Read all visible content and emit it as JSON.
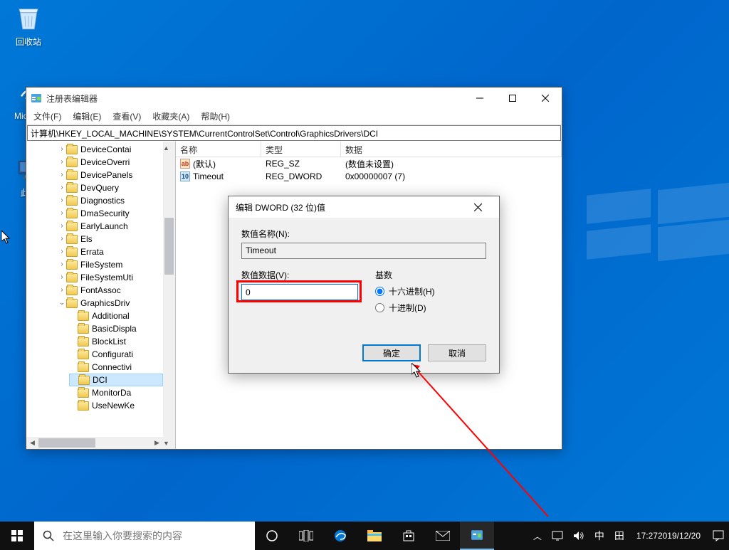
{
  "desktop": {
    "recycle": "回收站",
    "edge": "Mic... E",
    "thispc": "此..."
  },
  "regedit": {
    "title": "注册表编辑器",
    "menu": {
      "file": "文件(F)",
      "edit": "编辑(E)",
      "view": "查看(V)",
      "fav": "收藏夹(A)",
      "help": "帮助(H)"
    },
    "path": "计算机\\HKEY_LOCAL_MACHINE\\SYSTEM\\CurrentControlSet\\Control\\GraphicsDrivers\\DCI",
    "cols": {
      "name": "名称",
      "type": "类型",
      "data": "数据"
    },
    "rows": [
      {
        "icon": "sz",
        "name": "(默认)",
        "type": "REG_SZ",
        "data": "(数值未设置)"
      },
      {
        "icon": "dw",
        "name": "Timeout",
        "type": "REG_DWORD",
        "data": "0x00000007 (7)"
      }
    ],
    "tree": {
      "items": [
        "DeviceContai",
        "DeviceOverri",
        "DevicePanels",
        "DevQuery",
        "Diagnostics",
        "DmaSecurity",
        "EarlyLaunch",
        "Els",
        "Errata",
        "FileSystem",
        "FileSystemUti",
        "FontAssoc"
      ],
      "gd": "GraphicsDriv",
      "gdchildren": [
        "Additional",
        "BasicDispla",
        "BlockList",
        "Configurati",
        "Connectivi",
        "DCI",
        "MonitorDa",
        "UseNewKe"
      ]
    }
  },
  "dialog": {
    "title": "编辑 DWORD (32 位)值",
    "nameLabel": "数值名称(N):",
    "nameValue": "Timeout",
    "dataLabel": "数值数据(V):",
    "dataValue": "0",
    "baseLabel": "基数",
    "hex": "十六进制(H)",
    "dec": "十进制(D)",
    "ok": "确定",
    "cancel": "取消"
  },
  "taskbar": {
    "searchPlaceholder": "在这里输入你要搜索的内容",
    "ime": "中",
    "ime2": "田",
    "time": "17:27",
    "date": "2019/12/20"
  }
}
